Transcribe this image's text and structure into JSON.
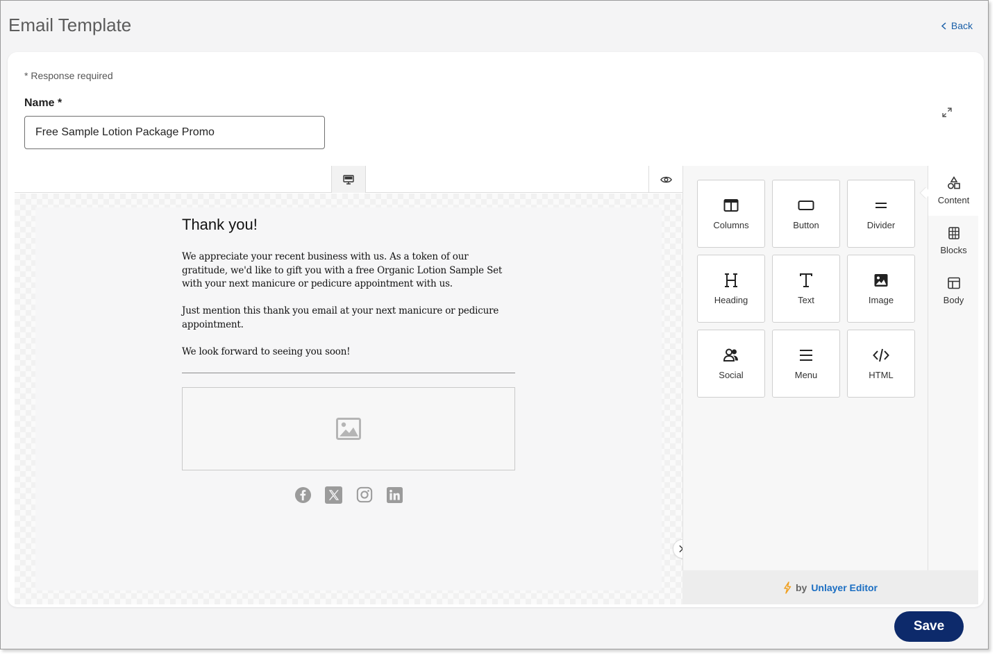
{
  "page": {
    "title": "Email Template",
    "back_label": "Back"
  },
  "form": {
    "required_note": "* Response required",
    "name_label": "Name *",
    "name_value": "Free Sample Lotion Package Promo"
  },
  "email": {
    "heading": "Thank you!",
    "paragraph1": "We appreciate your recent business with us. As a token of our gratitude, we'd like to gift you with a free Organic Lotion Sample Set with your next manicure or pedicure appointment with us.",
    "paragraph2": "Just mention this thank you email at your next manicure or pedicure appointment.",
    "paragraph3": "We look forward to seeing you soon!",
    "social_icons": [
      "facebook-icon",
      "x-icon",
      "instagram-icon",
      "linkedin-icon"
    ]
  },
  "tools": [
    {
      "label": "Columns",
      "icon": "columns-icon"
    },
    {
      "label": "Button",
      "icon": "button-icon"
    },
    {
      "label": "Divider",
      "icon": "divider-icon"
    },
    {
      "label": "Heading",
      "icon": "heading-icon"
    },
    {
      "label": "Text",
      "icon": "text-icon"
    },
    {
      "label": "Image",
      "icon": "image-icon"
    },
    {
      "label": "Social",
      "icon": "social-icon"
    },
    {
      "label": "Menu",
      "icon": "menu-icon"
    },
    {
      "label": "HTML",
      "icon": "html-icon"
    }
  ],
  "side_tabs": [
    {
      "label": "Content",
      "icon": "shapes-icon",
      "active": true
    },
    {
      "label": "Blocks",
      "icon": "blocks-icon",
      "active": false
    },
    {
      "label": "Body",
      "icon": "body-layout-icon",
      "active": false
    }
  ],
  "footer": {
    "by_label": "by",
    "brand_label": "Unlayer Editor",
    "save_label": "Save"
  },
  "colors": {
    "accent": "#1a5fa8",
    "save_button": "#0d2a6b",
    "brand_link": "#1b6ec2",
    "bolt": "#f0a020"
  }
}
